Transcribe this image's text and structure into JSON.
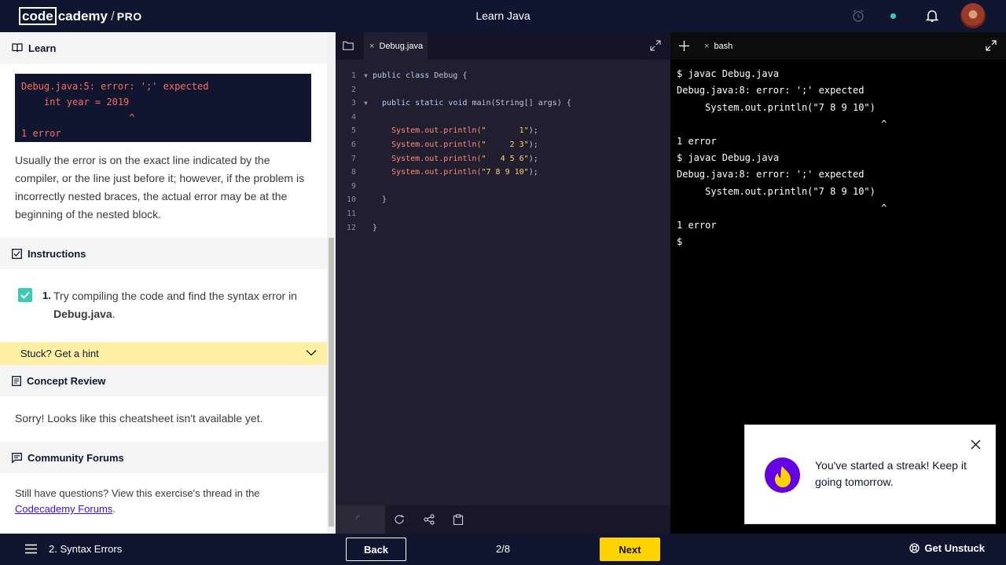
{
  "header": {
    "logo_code": "code",
    "logo_academy": "cademy",
    "logo_slash": "/",
    "logo_pro": "PRO",
    "title": "Learn Java"
  },
  "learn": {
    "heading": "Learn",
    "error_block": "Debug.java:5: error: ';' expected\n    int year = 2019\n                   ^\n1 error",
    "explanation": "Usually the error is on the exact line indicated by the compiler, or the line just before it; however, if the problem is incorrectly nested braces, the actual error may be at the beginning of the nested block."
  },
  "instructions": {
    "heading": "Instructions",
    "number": "1.",
    "text_before": "Try compiling the code and find the syntax error in ",
    "file": "Debug.java",
    "text_after": "."
  },
  "hint": {
    "label": "Stuck? Get a hint"
  },
  "concept_review": {
    "heading": "Concept Review",
    "text": "Sorry! Looks like this cheatsheet isn't available yet."
  },
  "forums": {
    "heading": "Community Forums",
    "text_before": "Still have questions? View this exercise's thread in the ",
    "link": "Codecademy Forums",
    "text_after": "."
  },
  "editor": {
    "tab_close": "×",
    "tab_label": "Debug.java",
    "line_numbers": [
      "1",
      "2",
      "3",
      "4",
      "5",
      "6",
      "7",
      "8",
      "9",
      "10",
      "11",
      "12"
    ],
    "lines": [
      {
        "kw": "public class ",
        "rest": "Debug {"
      },
      {
        "kw": "",
        "rest": ""
      },
      {
        "kw": "  public static void ",
        "rest": "main(String[] args) {"
      },
      {
        "kw": "",
        "rest": ""
      },
      {
        "call": "    System.out.println(",
        "str": "\"       1\"",
        "end": ");"
      },
      {
        "call": "    System.out.println(",
        "str": "\"     2 3\"",
        "end": ");"
      },
      {
        "call": "    System.out.println(",
        "str": "\"   4 5 6\"",
        "end": ");"
      },
      {
        "call": "    System.out.println(",
        "str": "\"7 8 9 10\"",
        "end": ");"
      },
      {
        "kw": "",
        "rest": ""
      },
      {
        "kw": "",
        "rest": "  }"
      },
      {
        "kw": "",
        "rest": ""
      },
      {
        "kw": "",
        "rest": "}"
      }
    ]
  },
  "terminal": {
    "tab_close": "×",
    "tab_label": "bash",
    "output": "$ javac Debug.java\nDebug.java:8: error: ';' expected\n     System.out.println(\"7 8 9 10\")\n                                    ^\n1 error\n$ javac Debug.java\nDebug.java:8: error: ';' expected\n     System.out.println(\"7 8 9 10\")\n                                    ^\n1 error\n$"
  },
  "toast": {
    "text": "You've started a streak! Keep it going tomorrow."
  },
  "footer": {
    "lesson": "2. Syntax Errors",
    "back_label": "Back",
    "progress": "2/8",
    "next_label": "Next",
    "unstuck_label": "Get Unstuck"
  },
  "colors": {
    "navy": "#10162f",
    "accent_yellow": "#ffd300",
    "hint_yellow": "#fff0a3",
    "check_teal": "#3cc9b5",
    "toast_purple": "#6400e4",
    "link_blue": "#3a10e5"
  }
}
